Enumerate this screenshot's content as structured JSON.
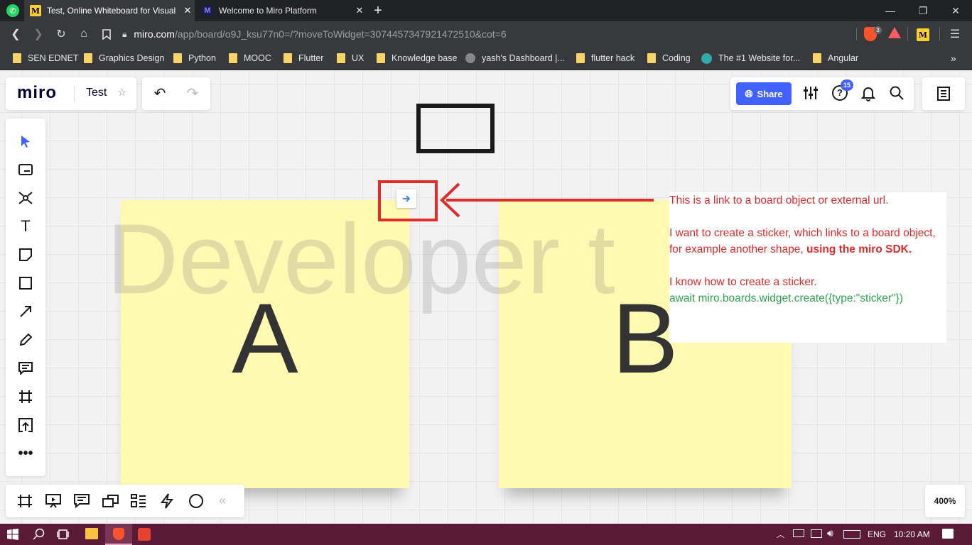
{
  "browser": {
    "tabs": [
      {
        "title": "Test, Online Whiteboard for Visual",
        "icon": "miro-favicon",
        "active": true
      },
      {
        "title": "Welcome to Miro Platform",
        "icon": "miro-dev-favicon",
        "active": false
      }
    ],
    "new_tab_label": "+",
    "url_host": "miro.com",
    "url_path": "/app/board/o9J_ksu77n0=/?moveToWidget=3074457347921472510&cot=6",
    "brave_badge": "3",
    "bookmarks": [
      "SEN EDNET",
      "Graphics Design",
      "Python",
      "MOOC",
      "Flutter",
      "UX",
      "Knowledge base",
      "yash's Dashboard |...",
      "flutter hack",
      "Coding",
      "The #1 Website for...",
      "Angular"
    ],
    "more_bookmarks": "»"
  },
  "miro": {
    "logo": "miro",
    "board_name": "Test",
    "share_label": "Share",
    "help_badge": "15",
    "zoom": "400%",
    "accent_color": "#4262ff",
    "left_tools": [
      "select-icon",
      "template-icon",
      "mind-map-icon",
      "text-icon",
      "sticky-note-icon",
      "shape-icon",
      "arrow-icon",
      "pen-icon",
      "comment-icon",
      "frame-icon",
      "upload-icon",
      "more-icon"
    ],
    "bottom_tools": [
      "frames-icon",
      "presentation-icon",
      "comments-icon",
      "cards-icon",
      "kanban-icon",
      "power-icon",
      "circle-icon",
      "collapse-icon"
    ]
  },
  "canvas": {
    "watermark": "Developer t",
    "sticker_a": "A",
    "sticker_b": "B",
    "sticky_color": "#fff9b1",
    "annotation_color": "#e02b2b",
    "note": {
      "line1": "This is a link to a board object or external url.",
      "line2": "I want to create a sticker, which links to a board object, for example another shape, ",
      "line2_bold": "using the miro SDK.",
      "line3": "I know how to create a sticker.",
      "code": "await miro.boards.widget.create({type:\"sticker\"})"
    }
  },
  "taskbar": {
    "lang": "ENG",
    "time": "10:20 AM"
  }
}
